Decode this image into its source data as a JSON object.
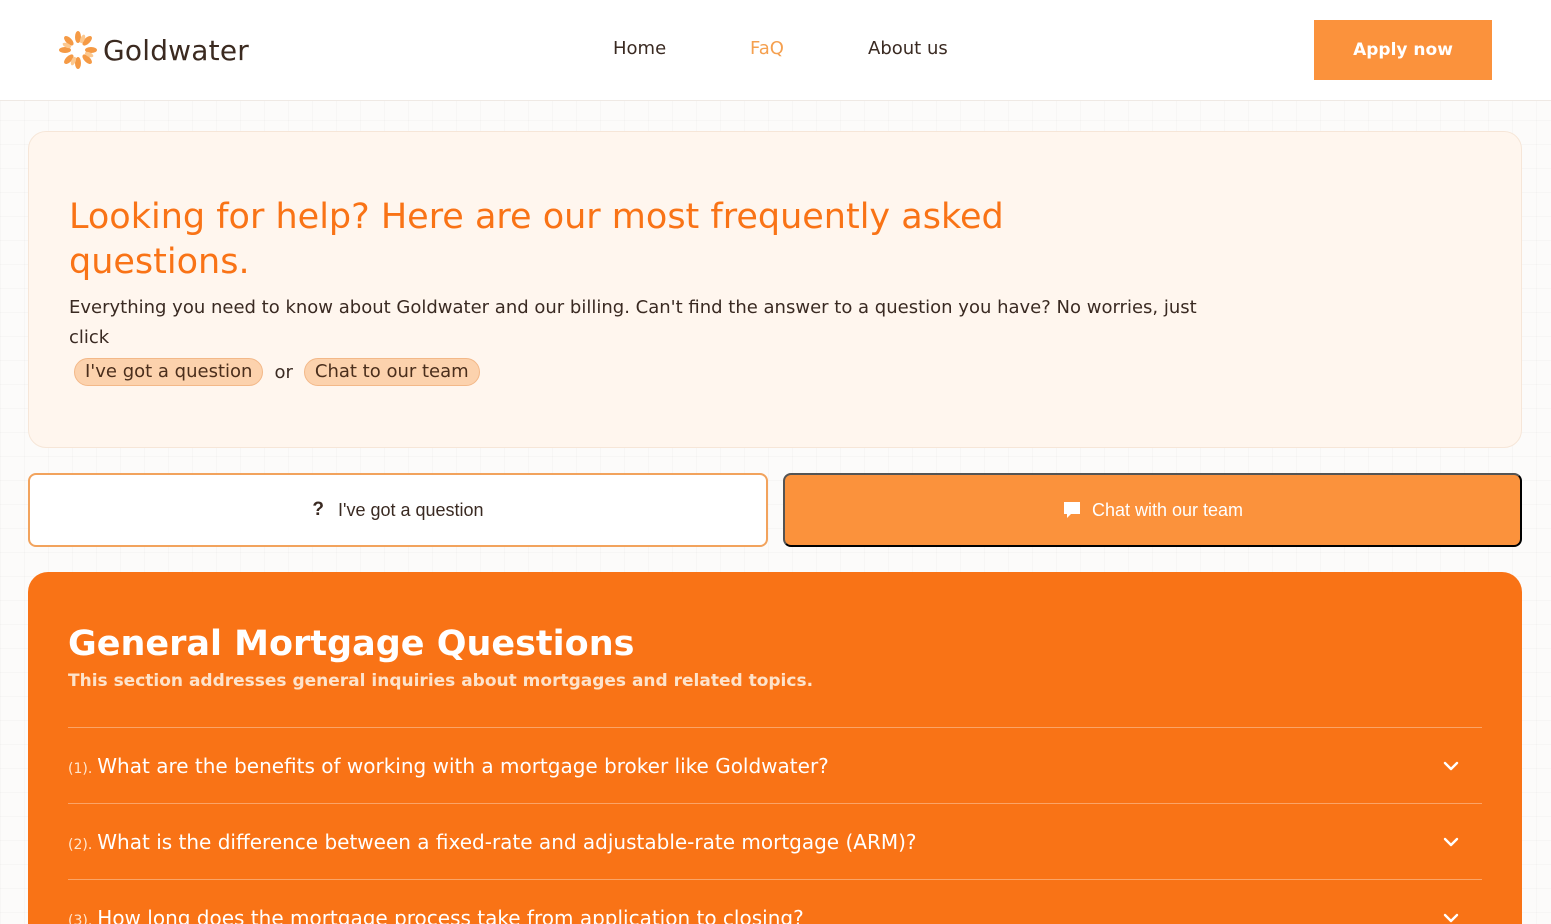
{
  "header": {
    "brand": "Goldwater",
    "nav": [
      {
        "label": "Home",
        "active": false
      },
      {
        "label": "FaQ",
        "active": true
      },
      {
        "label": "About us",
        "active": false
      }
    ],
    "cta_label": "Apply now"
  },
  "hero": {
    "title": "Looking for help? Here are our most frequently asked questions.",
    "subtitle": "Everything you need to know about Goldwater and our billing. Can't find the answer to a question you have? No worries, just click",
    "link_question": "I've got a question",
    "or_text": "or",
    "link_chat": "Chat to our team"
  },
  "actions": {
    "question_icon": "?",
    "question_label": "I've got a question",
    "chat_icon": "chat-bubble-icon",
    "chat_label": "Chat with our team"
  },
  "faq": {
    "title": "General Mortgage Questions",
    "subtitle": "This section addresses general inquiries about mortgages and related topics.",
    "items": [
      {
        "num": "(1).",
        "question": "What are the benefits of working with a mortgage broker like Goldwater?"
      },
      {
        "num": "(2).",
        "question": "What is the difference between a fixed-rate and adjustable-rate mortgage (ARM)?"
      },
      {
        "num": "(3).",
        "question": "How long does the mortgage process take from application to closing?"
      }
    ]
  },
  "colors": {
    "accent": "#f97316",
    "button": "#fb923c",
    "hero_bg": "#fff6ee",
    "pill_bg": "#fcd2ad",
    "nav_active": "#f5a04f"
  }
}
